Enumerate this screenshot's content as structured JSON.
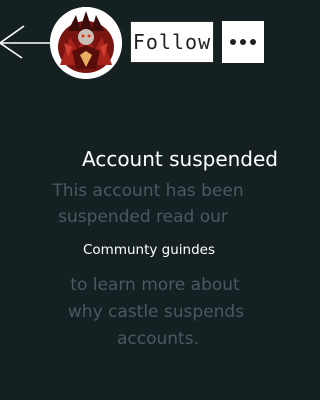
{
  "header": {
    "follow_label": "Follow",
    "back_icon": "back-arrow-icon",
    "more_icon": "more-dots-icon"
  },
  "notice": {
    "title": "Account suspended",
    "line1": "This account has been",
    "line2": "suspended read our",
    "guidelines_link": "Communty guindes",
    "line3": "to learn more about",
    "line4": "why castle suspends",
    "line5": "accounts."
  },
  "colors": {
    "background": "#142021",
    "muted_text": "#4a5a61",
    "primary_text": "#ffffff"
  }
}
